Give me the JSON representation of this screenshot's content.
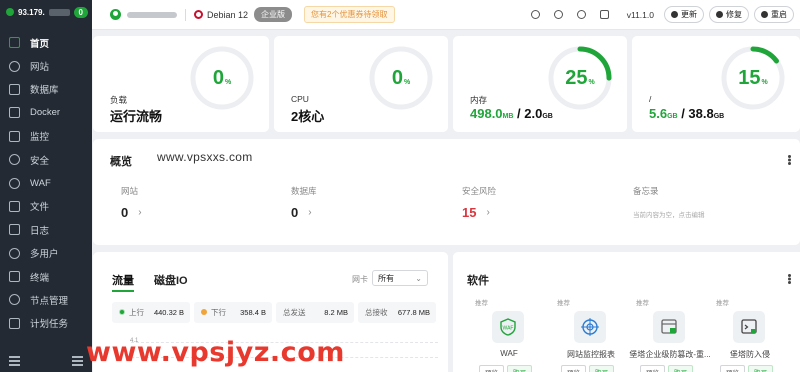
{
  "sidebar": {
    "ip": "93.179.",
    "badge": "0",
    "items": [
      {
        "label": "首页",
        "active": true
      },
      {
        "label": "网站"
      },
      {
        "label": "数据库"
      },
      {
        "label": "Docker"
      },
      {
        "label": "监控"
      },
      {
        "label": "安全"
      },
      {
        "label": "WAF"
      },
      {
        "label": "文件"
      },
      {
        "label": "日志"
      },
      {
        "label": "多用户"
      },
      {
        "label": "终端"
      },
      {
        "label": "节点管理"
      },
      {
        "label": "计划任务"
      }
    ]
  },
  "topbar": {
    "os": "Debian 12",
    "edition": "企业版",
    "notice": "您有2个优惠券待领取",
    "version": "v11.1.0",
    "buttons": {
      "update": "更新",
      "repair": "修复",
      "restart": "重启"
    }
  },
  "metrics": [
    {
      "label": "负载",
      "value": "运行流畅",
      "percent": "0",
      "unit": "%"
    },
    {
      "label": "CPU",
      "value": "2核心",
      "percent": "0",
      "unit": "%"
    },
    {
      "label": "内存",
      "value_used": "498.0",
      "unit_used": "MB",
      "value_total": "2.0",
      "unit_total": "GB",
      "percent": "25",
      "unit": "%"
    },
    {
      "label": "/",
      "value_used": "5.6",
      "unit_used": "GB",
      "value_total": "38.8",
      "unit_total": "GB",
      "percent": "15",
      "unit": "%"
    }
  ],
  "overview": {
    "title": "概览",
    "site": "www.vpsxxs.com",
    "items": [
      {
        "label": "网站",
        "value": "0"
      },
      {
        "label": "数据库",
        "value": "0"
      },
      {
        "label": "安全风险",
        "value": "15"
      },
      {
        "label": "备忘录",
        "text": "当前内容为空，点击编辑"
      }
    ]
  },
  "traffic": {
    "tab_flow": "流量",
    "tab_disk": "磁盘IO",
    "nic_label": "网卡",
    "nic_value": "所有",
    "up_label": "上行",
    "up_value": "440.32 B",
    "down_label": "下行",
    "down_value": "358.4 B",
    "sent_label": "总发送",
    "sent_value": "8.2 MB",
    "recv_label": "总接收",
    "recv_value": "677.8 MB",
    "y_tick": "4.1"
  },
  "software": {
    "title": "软件",
    "apps": [
      {
        "tag": "推荐",
        "name": "WAF",
        "preview": "预览",
        "buy": "购买"
      },
      {
        "tag": "推荐",
        "name": "网站监控报表",
        "preview": "预览",
        "buy": "购买"
      },
      {
        "tag": "推荐",
        "name": "堡塔企业级防篡改-重...",
        "preview": "预览",
        "buy": "购买"
      },
      {
        "tag": "推荐",
        "name": "堡塔防入侵",
        "preview": "预览",
        "buy": "购买"
      }
    ]
  },
  "watermark": "www.vpsjyz.com",
  "colors": {
    "accent": "#20a53a",
    "danger": "#d9363e",
    "sidebar": "#232a33"
  }
}
